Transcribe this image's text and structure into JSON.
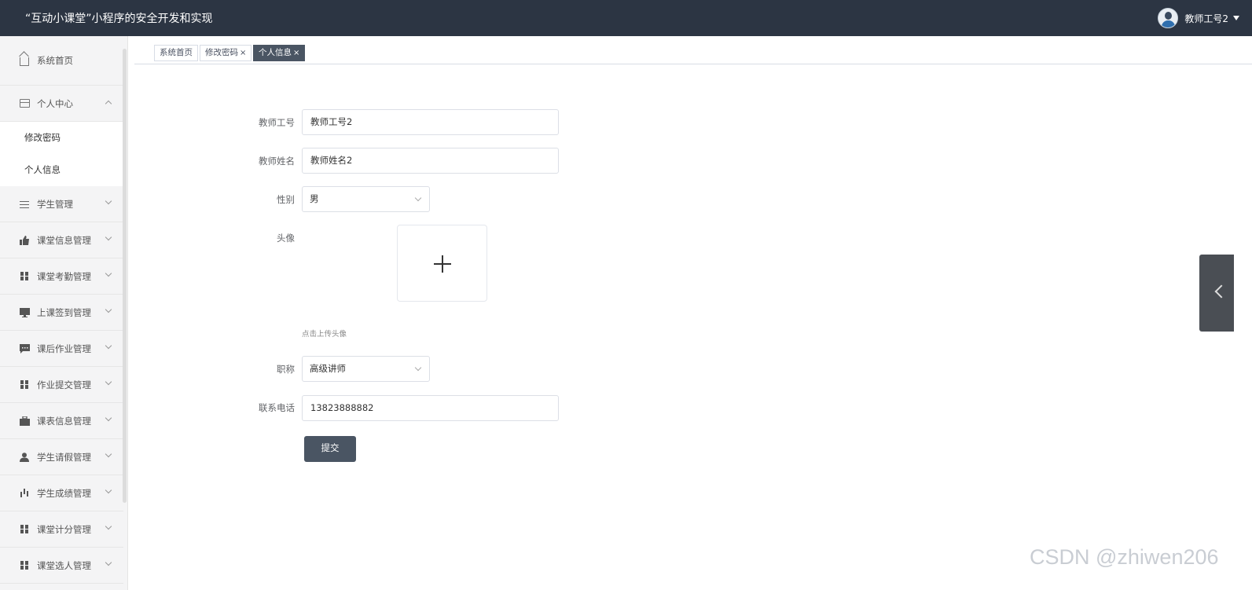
{
  "header": {
    "app_title": "“互动小课堂”小程序的安全开发和实现",
    "user_name": "教师工号2",
    "avatar_icon": "user-avatar-icon"
  },
  "sidebar": {
    "home": {
      "label": "系统首页",
      "icon": "home-icon"
    },
    "personal_center": {
      "label": "个人中心",
      "icon": "card-icon",
      "expanded": true,
      "children": [
        {
          "label": "修改密码"
        },
        {
          "label": "个人信息"
        }
      ]
    },
    "items": [
      {
        "label": "学生管理",
        "icon": "sliders-icon"
      },
      {
        "label": "课堂信息管理",
        "icon": "thumb-icon"
      },
      {
        "label": "课堂考勤管理",
        "icon": "grid-icon"
      },
      {
        "label": "上课签到管理",
        "icon": "monitor-icon"
      },
      {
        "label": "课后作业管理",
        "icon": "chat-icon"
      },
      {
        "label": "作业提交管理",
        "icon": "grid-icon"
      },
      {
        "label": "课表信息管理",
        "icon": "briefcase-icon"
      },
      {
        "label": "学生请假管理",
        "icon": "person-icon"
      },
      {
        "label": "学生成绩管理",
        "icon": "bar-chart-icon"
      },
      {
        "label": "课堂计分管理",
        "icon": "grid-icon"
      },
      {
        "label": "课堂选人管理",
        "icon": "grid-icon"
      }
    ]
  },
  "tabs": [
    {
      "label": "系统首页",
      "closable": false,
      "active": false
    },
    {
      "label": "修改密码",
      "closable": true,
      "active": false
    },
    {
      "label": "个人信息",
      "closable": true,
      "active": true
    }
  ],
  "tab_close_glyph": "×",
  "form": {
    "teacher_id": {
      "label": "教师工号",
      "value": "教师工号2"
    },
    "teacher_name": {
      "label": "教师姓名",
      "value": "教师姓名2"
    },
    "gender": {
      "label": "性别",
      "value": "男"
    },
    "avatar": {
      "label": "头像",
      "tip": "点击上传头像"
    },
    "title": {
      "label": "职称",
      "value": "高级讲师"
    },
    "phone": {
      "label": "联系电话",
      "value": "13823888882"
    },
    "submit_label": "提交"
  },
  "watermark": "CSDN @zhiwen206",
  "colors": {
    "header_bg": "#2c3543",
    "accent": "#4a5563",
    "sidebar_bg": "#f4f4f5"
  }
}
